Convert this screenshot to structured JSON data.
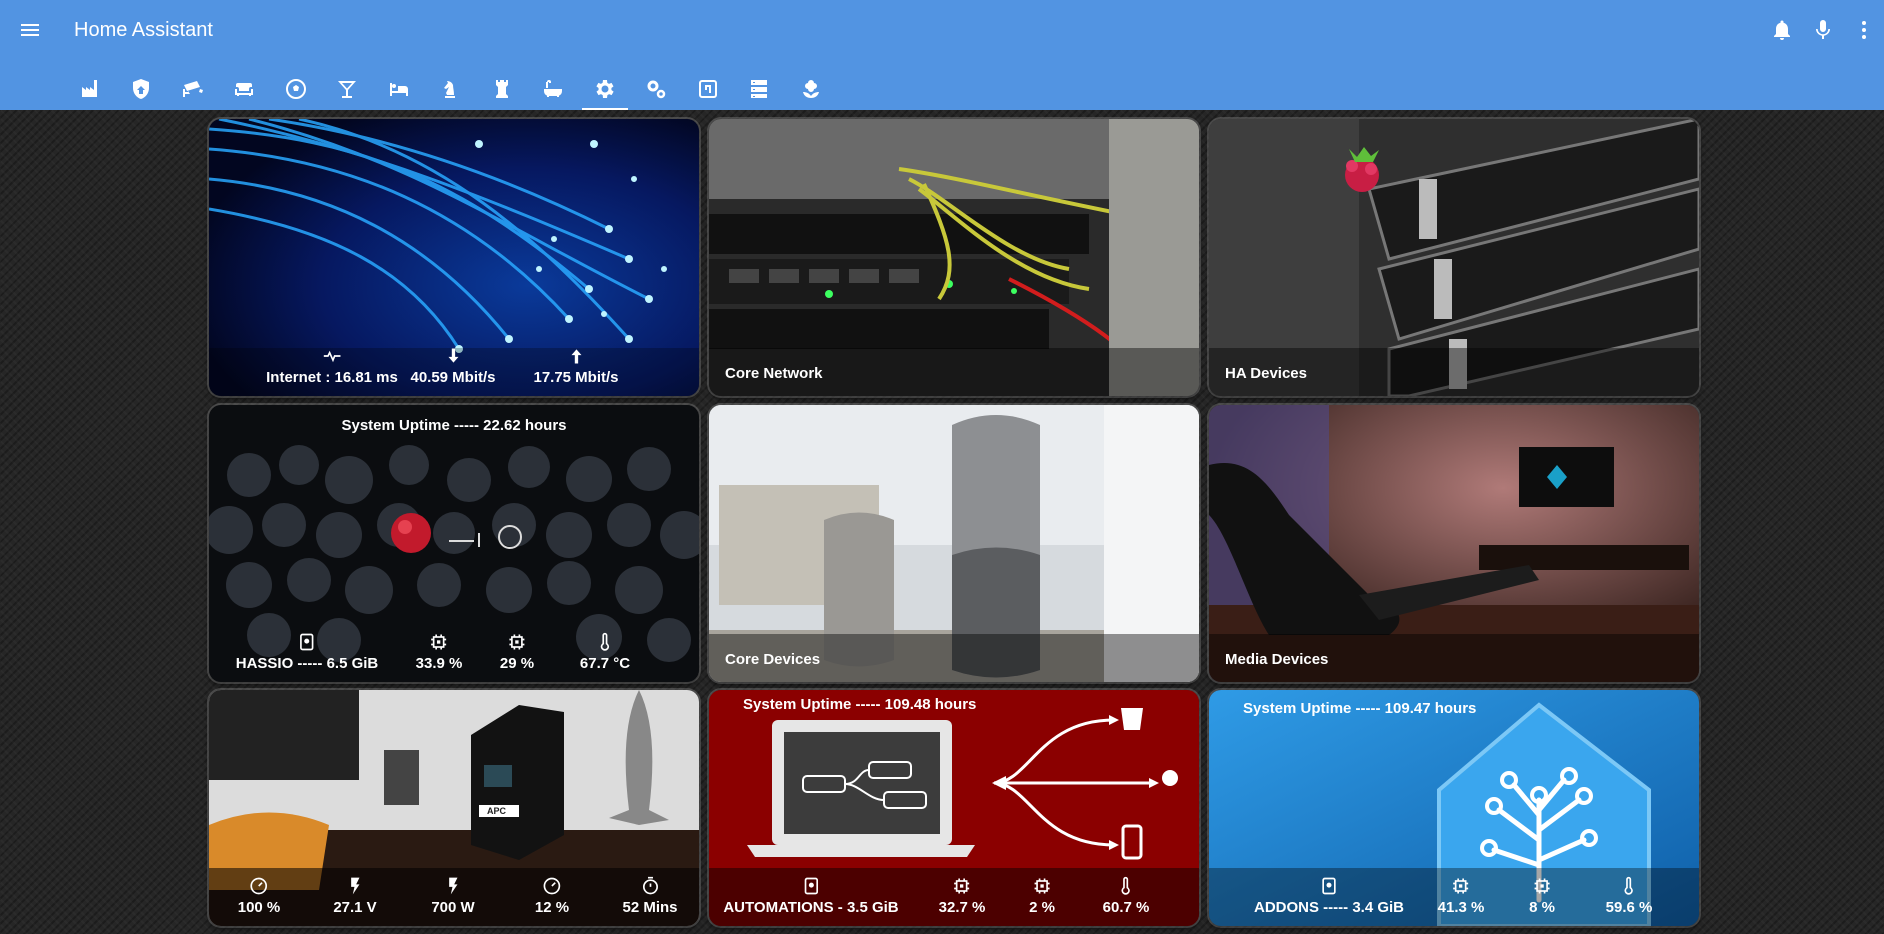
{
  "app": {
    "title": "Home Assistant"
  },
  "header_icons": [
    "menu-icon",
    "bell-icon",
    "microphone-icon",
    "more-vertical-icon"
  ],
  "tabs": [
    {
      "icon": "factory-icon"
    },
    {
      "icon": "shield-home-icon"
    },
    {
      "icon": "cctv-icon"
    },
    {
      "icon": "sofa-icon"
    },
    {
      "icon": "soccer-icon"
    },
    {
      "icon": "glass-cocktail-icon"
    },
    {
      "icon": "bed-icon"
    },
    {
      "icon": "chess-knight-icon"
    },
    {
      "icon": "chess-rook-icon"
    },
    {
      "icon": "bathtub-icon"
    },
    {
      "icon": "settings-icon",
      "active": true
    },
    {
      "icon": "cogs-icon"
    },
    {
      "icon": "nfc-icon"
    },
    {
      "icon": "server-icon"
    },
    {
      "icon": "flower-icon"
    }
  ],
  "cards": {
    "internet": {
      "stats": [
        "Internet : 16.81 ms",
        "40.59 Mbit/s",
        "17.75 Mbit/s"
      ]
    },
    "core_network": {
      "name": "Core Network"
    },
    "ha_devices": {
      "name": "HA Devices"
    },
    "hassio": {
      "uptime": "System Uptime ----- 22.62 hours",
      "stats": [
        "HASSIO ----- 6.5 GiB",
        "33.9 %",
        "29 %",
        "67.7 °C"
      ]
    },
    "core_devices": {
      "name": "Core Devices"
    },
    "media_devices": {
      "name": "Media Devices"
    },
    "ups": {
      "stats": [
        "100 %",
        "27.1 V",
        "700 W",
        "12 %",
        "52 Mins"
      ],
      "brand": "APC"
    },
    "automations": {
      "uptime": "System Uptime ----- 109.48 hours",
      "stats": [
        "AUTOMATIONS - 3.5 GiB",
        "32.7 %",
        "2 %",
        "60.7 %"
      ]
    },
    "addons": {
      "uptime": "System Uptime ----- 109.47 hours",
      "stats": [
        "ADDONS ----- 3.4 GiB",
        "41.3 %",
        "8 %",
        "59.6 %"
      ]
    }
  }
}
